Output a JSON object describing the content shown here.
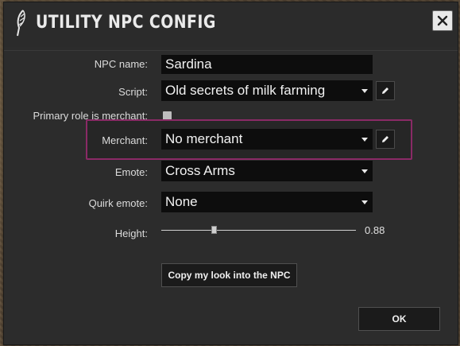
{
  "window": {
    "title": "UTILITY NPC CONFIG"
  },
  "form": {
    "npc_name": {
      "label": "NPC name:",
      "value": "Sardina"
    },
    "script": {
      "label": "Script:",
      "value": "Old secrets of milk farming"
    },
    "primary_role": {
      "label": "Primary role is merchant:",
      "checked": false
    },
    "merchant": {
      "label": "Merchant:",
      "value": "No merchant"
    },
    "emote": {
      "label": "Emote:",
      "value": "Cross Arms"
    },
    "quirk_emote": {
      "label": "Quirk emote:",
      "value": "None"
    },
    "height": {
      "label": "Height:",
      "value": "0.88",
      "slider_fraction": 0.27
    }
  },
  "buttons": {
    "copy_look": "Copy my look into the NPC",
    "ok": "OK"
  },
  "colors": {
    "window_bg": "#2c2c2c",
    "field_bg": "#0d0d0d",
    "highlight_border": "#8a2a66"
  },
  "icons": {
    "title_logo": "feather-logo-icon",
    "close": "close-icon",
    "edit": "pencil-icon",
    "dropdown": "chevron-down-icon"
  }
}
